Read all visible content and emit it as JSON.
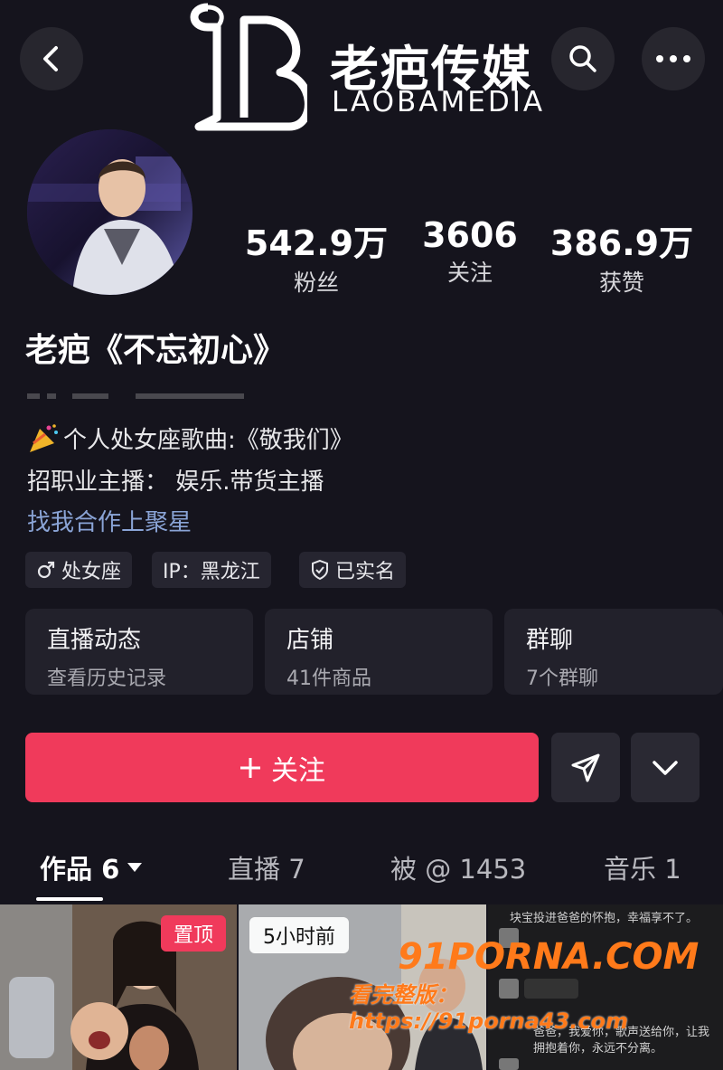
{
  "header": {
    "back_icon": "chevron-left-icon",
    "search_icon": "search-icon",
    "more_icon": "more-horizontal-icon",
    "logo_cn": "老疤传媒",
    "logo_en": "LAOBAMEDIA"
  },
  "profile": {
    "name": "老疤《不忘初心》",
    "stats": [
      {
        "value": "542.9万",
        "label": "粉丝"
      },
      {
        "value": "3606",
        "label": "关注"
      },
      {
        "value": "386.9万",
        "label": "获赞"
      }
    ],
    "bio_line1": "个人处女座歌曲:《敬我们》",
    "bio_line2": "招职业主播： 娱乐.带货主播",
    "bio_link": "找我合作上聚星",
    "tags": [
      {
        "icon": "male-icon",
        "label": "处女座"
      },
      {
        "icon": "",
        "label": "IP：黑龙江"
      },
      {
        "icon": "shield-check-icon",
        "label": "已实名"
      }
    ]
  },
  "cards": [
    {
      "title": "直播动态",
      "sub": "查看历史记录"
    },
    {
      "title": "店铺",
      "sub": "41件商品"
    },
    {
      "title": "群聊",
      "sub": "7个群聊"
    }
  ],
  "actions": {
    "follow_label": "关注",
    "plus_icon": "plus-icon",
    "share_icon": "send-icon",
    "expand_icon": "chevron-down-icon"
  },
  "tabs": [
    {
      "label": "作品 6"
    },
    {
      "label": "直播 7"
    },
    {
      "label": "被 @ 1453"
    },
    {
      "label": "音乐 1"
    }
  ],
  "videos": {
    "pinned_badge": "置顶",
    "time_badge": "5小时前",
    "chat_top": "块宝投进爸爸的怀抱，幸福享不了。",
    "chat_bottom1": "爸爸，我爱你，歌声送给你，让我",
    "chat_bottom2": "拥抱着你，永远不分离。"
  },
  "watermark": {
    "site": "91PORNA.COM",
    "url": "看完整版：https://91porna43.com"
  },
  "colors": {
    "background": "#15141d",
    "accent": "#f03a5b",
    "link": "#8aa4d6"
  }
}
